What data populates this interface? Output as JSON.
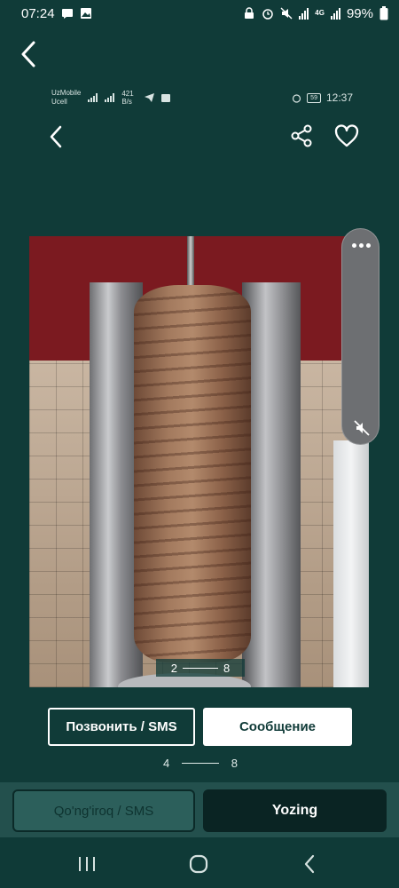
{
  "status_bar": {
    "time": "07:24",
    "battery": "99%"
  },
  "inner_status": {
    "carrier1": "UzMobile",
    "carrier2": "Ucell",
    "net_speed": "421 B/s",
    "battery": "59",
    "time": "12:37"
  },
  "photo": {
    "counter_current": "2",
    "counter_total": "8"
  },
  "actions": {
    "call_sms": "Позвонить / SMS",
    "message": "Сообщение"
  },
  "pager": {
    "current": "4",
    "total": "8"
  },
  "bottom_bar": {
    "call_label": "Qo'ng'iroq / SMS",
    "write_label": "Yozing"
  },
  "icons": {
    "outer_back": "chevron-left-icon",
    "inner_back": "chevron-left-icon",
    "share": "share-icon",
    "favorite": "heart-icon",
    "more": "more-dots-icon",
    "mute": "mute-icon"
  },
  "colors": {
    "background": "#103b38",
    "bottom_bar": "#23504d",
    "write_button": "#0a2423"
  }
}
